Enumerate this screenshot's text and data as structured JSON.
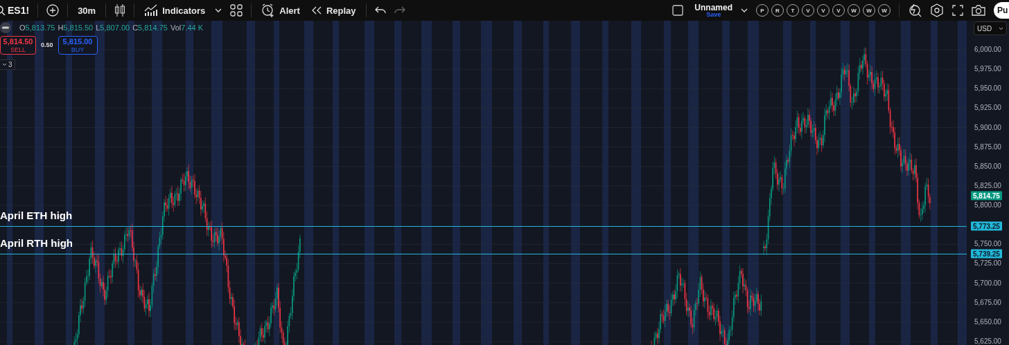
{
  "toolbar": {
    "symbol": "ES1!",
    "interval": "30m",
    "indicators": "Indicators",
    "alert": "Alert",
    "replay": "Replay",
    "layout_name": "Unnamed",
    "layout_save": "Save",
    "watchlist": [
      "P",
      "R",
      "T",
      "V",
      "V",
      "V",
      "W",
      "W",
      "W"
    ],
    "publish": "Pu"
  },
  "legend": [
    {
      "label": "O",
      "value": "5,813.75"
    },
    {
      "label": "H",
      "value": "5,815.50"
    },
    {
      "label": "L",
      "value": "5,807.00"
    },
    {
      "label": "C",
      "value": "5,814.75"
    },
    {
      "label": "Vol",
      "value": "7.44 K"
    }
  ],
  "trade": {
    "sell_price": "5,814.50",
    "sell_label": "SELL",
    "spread": "0.50",
    "buy_price": "5,815.00",
    "buy_label": "BUY"
  },
  "indicator_count": "3",
  "currency": "USD",
  "y_axis": [
    "6,000.00",
    "5,975.00",
    "5,950.00",
    "5,925.00",
    "5,900.00",
    "5,875.00",
    "5,850.00",
    "5,825.00",
    "5,800.00",
    "5,750.00",
    "5,725.00",
    "5,700.00",
    "5,675.00",
    "5,650.00",
    "5,625.00"
  ],
  "last_price": {
    "tag": "5,814.75",
    "color": "#089981"
  },
  "levels": [
    {
      "label": "April ETH high",
      "tag": "5,773.25",
      "color": "#22b8d8"
    },
    {
      "label": "April RTH high",
      "tag": "5,739.25",
      "color": "#22b8d8"
    }
  ]
}
